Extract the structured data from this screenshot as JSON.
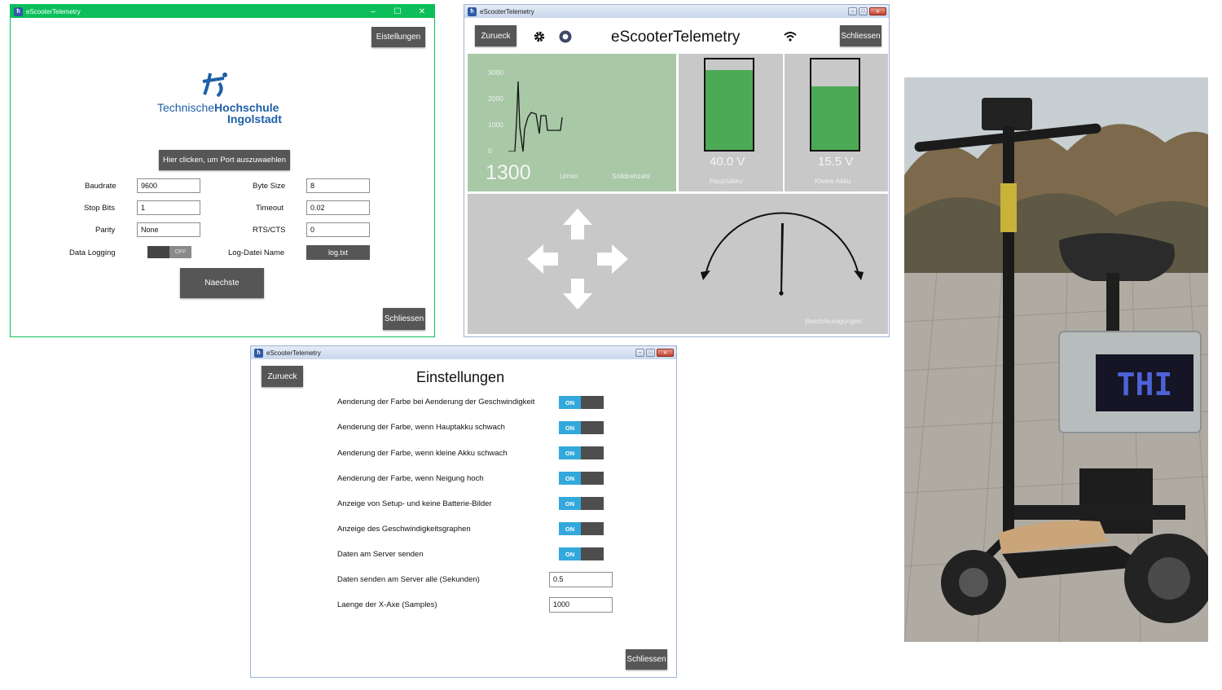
{
  "win1": {
    "title": "eScooterTelemetry",
    "settings_button": "Eistellungen",
    "logo": {
      "line1": "Technische",
      "line1b": "Hochschule",
      "line2": "Ingolstadt"
    },
    "port_button": "Hier clicken, um Port auszuwaehlen",
    "fields": {
      "baudrate_label": "Baudrate",
      "baudrate_value": "9600",
      "bytesize_label": "Byte Size",
      "bytesize_value": "8",
      "stopbits_label": "Stop Bits",
      "stopbits_value": "1",
      "timeout_label": "Timeout",
      "timeout_value": "0.02",
      "parity_label": "Parity",
      "parity_value": "None",
      "rtscts_label": "RTS/CTS",
      "rtscts_value": "0",
      "logging_label": "Data Logging",
      "logging_toggle": "OFF",
      "logfile_label": "Log-Datei Name",
      "logfile_value": "log.txt"
    },
    "next_button": "Naechste",
    "close_button": "Schliessen",
    "title_bar_color": "#0dbf5a"
  },
  "win2": {
    "title": "eScooterTelemetry",
    "back_button": "Zurueck",
    "app_title": "eScooterTelemetry",
    "close_button": "Schliessen",
    "gear_icon": "gear-icon",
    "record_icon": "record-icon",
    "wifi_icon": "wifi-icon",
    "speed_panel": {
      "y_ticks": [
        "3000",
        "2000",
        "1000",
        "0"
      ],
      "value": "1300",
      "unit": "U/min",
      "caption": "Solldrehzahl",
      "bg_color": "#a8c8a6"
    },
    "main_battery": {
      "value": "40.0 V",
      "label": "Hauptakku",
      "level": 0.88
    },
    "small_battery": {
      "value": "15.5 V",
      "label": "Kleine Akku",
      "level": 0.7
    },
    "accel_label": "Beschleunigungen",
    "battery_color": "#4caa54"
  },
  "win3": {
    "title": "eScooterTelemetry",
    "back_button": "Zurueck",
    "heading": "Einstellungen",
    "toggle_on_label": "ON",
    "options": [
      "Aenderung der Farbe bei Aenderung der Geschwindigkeit",
      "Aenderung der Farbe, wenn Hauptakku schwach",
      "Aenderung der Farbe, wenn kleine Akku schwach",
      "Aenderung der Farbe, wenn Neigung hoch",
      "Anzeige von Setup- und keine Batterie-Bilder",
      "Anzeige des Geschwindigkeitsgraphen",
      "Daten am Server senden"
    ],
    "inputs": [
      {
        "label": "Daten senden am Server alle (Sekunden)",
        "value": "0.5"
      },
      {
        "label": "Laenge der X-Axe (Samples)",
        "value": "1000"
      }
    ],
    "close_button": "Schliessen"
  },
  "photo": {
    "display_text": "THI"
  }
}
